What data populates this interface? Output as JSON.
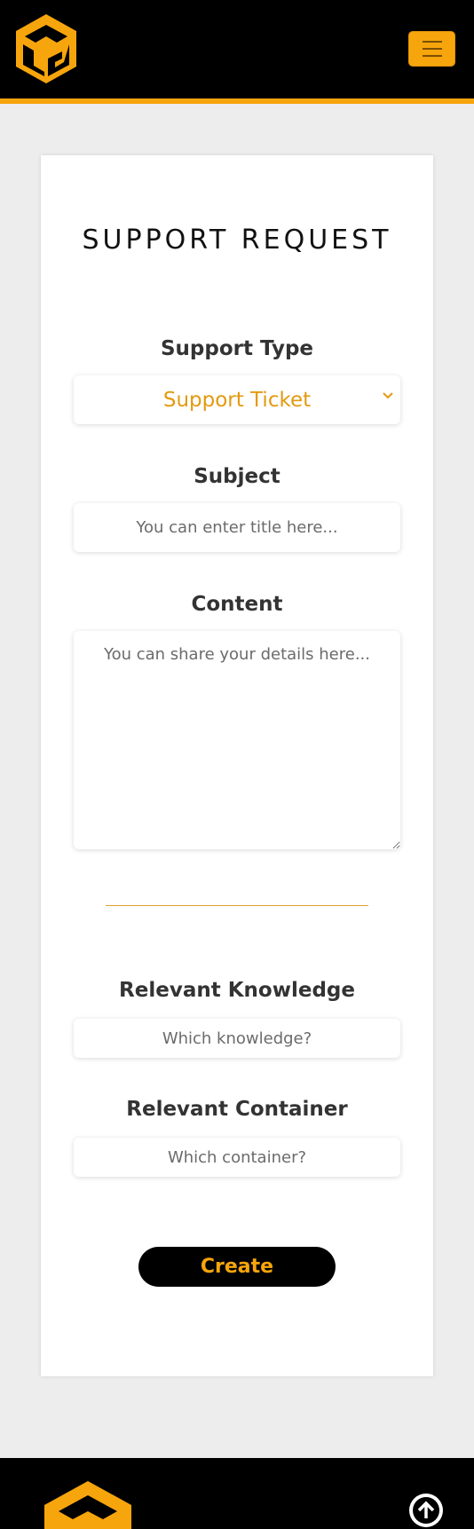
{
  "header": {
    "logo_icon": "cube-logo-icon",
    "menu_icon": "hamburger-menu-icon"
  },
  "form": {
    "title": "SUPPORT REQUEST",
    "support_type": {
      "label": "Support Type",
      "value": "Support Ticket",
      "icon": "chevron-down-icon"
    },
    "subject": {
      "label": "Subject",
      "placeholder": "You can enter title here..."
    },
    "content": {
      "label": "Content",
      "placeholder": "You can share your details here..."
    },
    "relevant_knowledge": {
      "label": "Relevant Knowledge",
      "placeholder": "Which knowledge?"
    },
    "relevant_container": {
      "label": "Relevant Container",
      "placeholder": "Which container?"
    },
    "submit_label": "Create"
  },
  "footer": {
    "scroll_top_icon": "arrow-up-icon"
  },
  "colors": {
    "accent": "#f7a50c",
    "header_bg": "#000000",
    "page_bg": "#eeedee"
  }
}
